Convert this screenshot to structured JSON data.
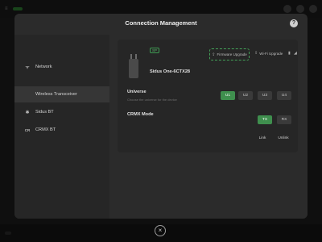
{
  "modal": {
    "title": "Connection Management",
    "help_glyph": "?"
  },
  "sidebar": {
    "items": [
      {
        "label": "Network",
        "icon": "wifi-icon",
        "glyph": "ᯤ"
      },
      {
        "label": "Wireless Transceiver",
        "icon": "transceiver-icon",
        "glyph": ""
      },
      {
        "label": "Sidus BT",
        "icon": "bluetooth-icon",
        "glyph": "✱"
      },
      {
        "label": "CRMX BT",
        "icon": "crmx-icon",
        "glyph": "CR"
      }
    ],
    "active_index": 1
  },
  "device": {
    "badge": "SP",
    "name": "Sidus One-6CTX28",
    "firmware_label": "Firmware Upgrade",
    "wifi_label": "Wi-Fi Upgrade"
  },
  "universe": {
    "title": "Universe",
    "subtitle": "Choose the universe for the device",
    "options": [
      "U1",
      "U2",
      "U3",
      "U4"
    ],
    "selected": "U1"
  },
  "crmx": {
    "title": "CRMX Mode",
    "options": [
      "TX",
      "RX"
    ],
    "selected": "TX",
    "link_label": "Link",
    "unlink_label": "Unlink"
  },
  "close_glyph": "×",
  "colors": {
    "accent": "#3f8f4e",
    "modal_bg": "#2b2b2b",
    "sidebar_bg": "#262626",
    "dashed_highlight": "#43a057"
  }
}
